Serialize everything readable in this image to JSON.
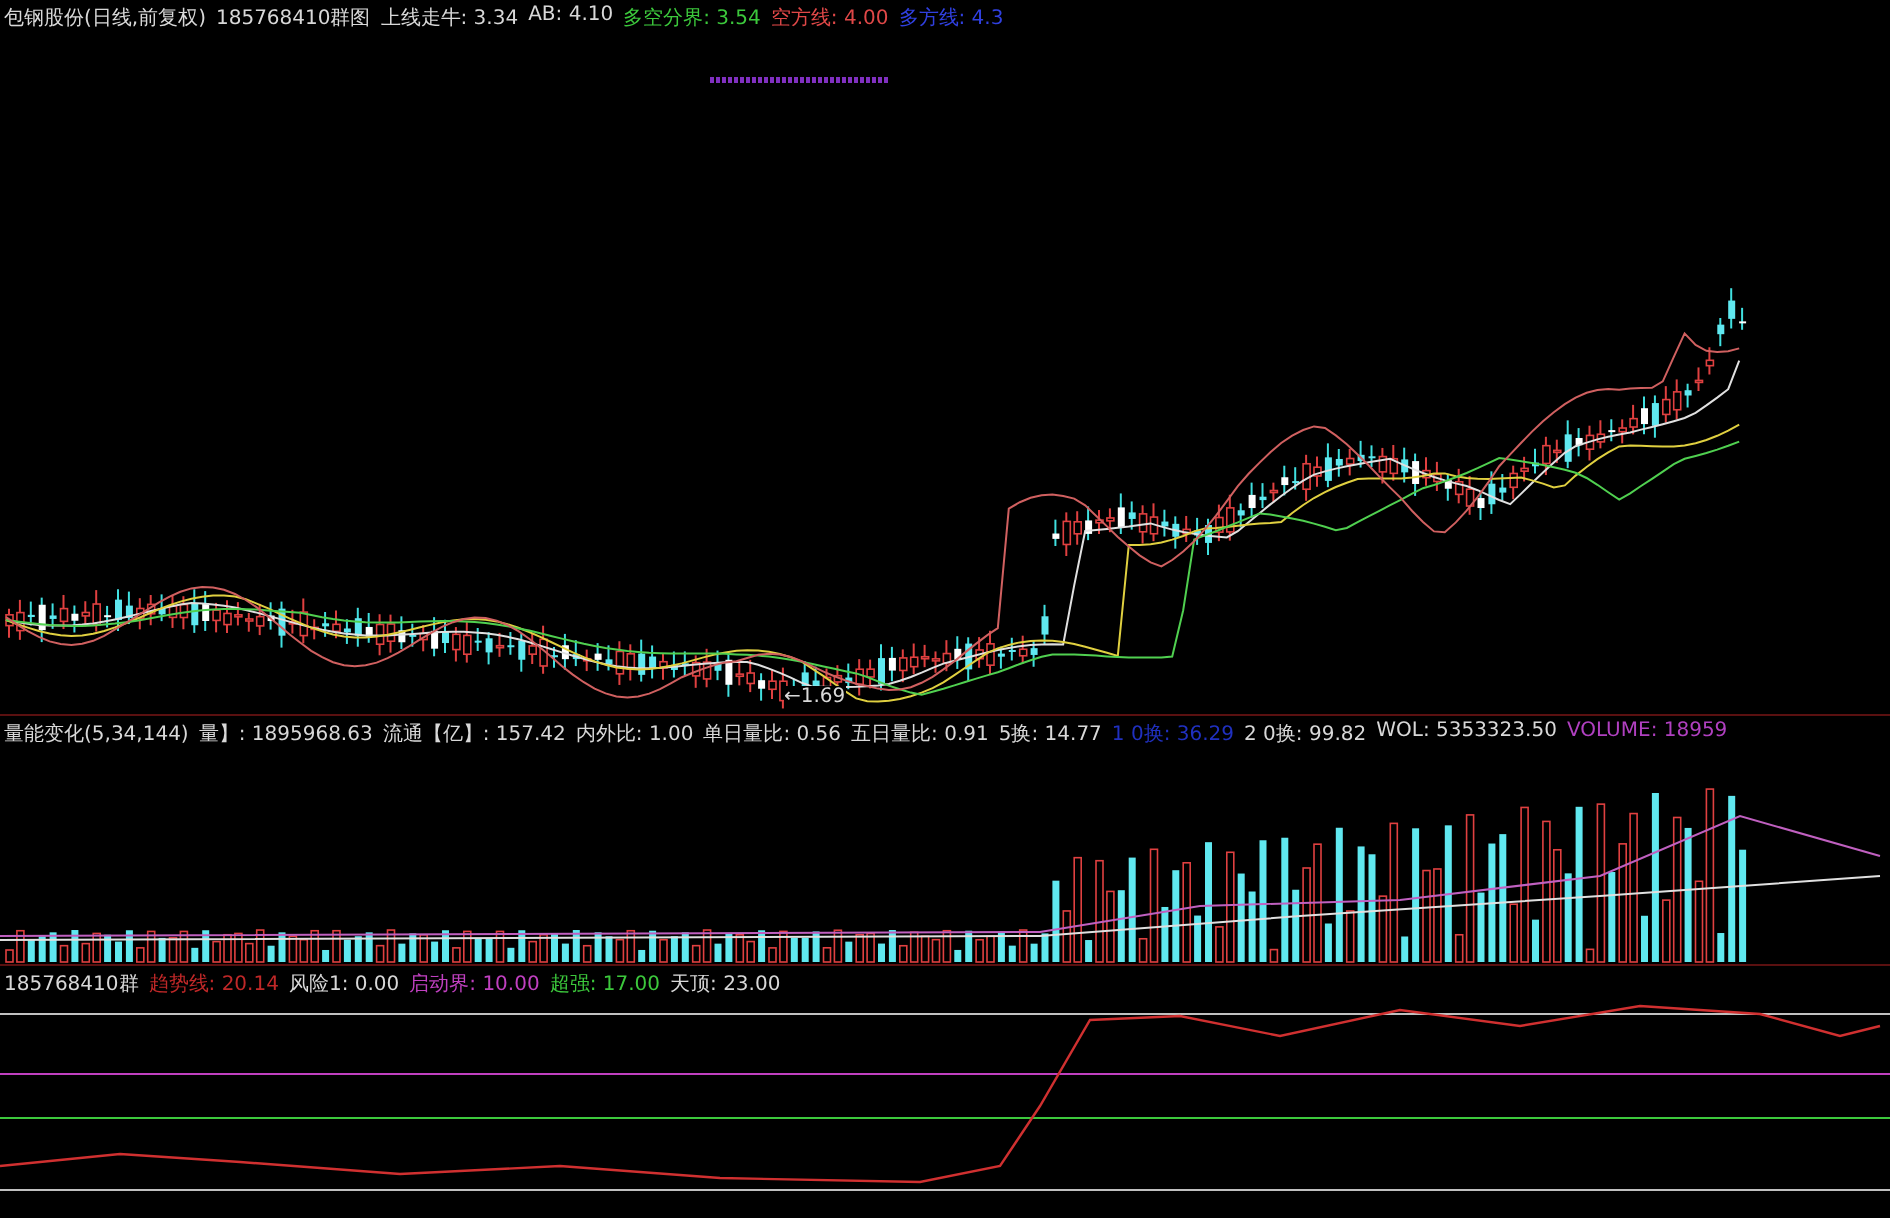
{
  "price_panel": {
    "title": "包钢股份(日线,前复权)",
    "legend": [
      {
        "label": "185768410群图",
        "color": "#d8d8d8"
      },
      {
        "label": "上线走牛: 3.34",
        "color": "#d8d8d8"
      },
      {
        "label": "AB: 4.10",
        "color": "#d8d8d8"
      },
      {
        "label": "多空分界: 3.54",
        "color": "#3cc83c"
      },
      {
        "label": "空方线: 4.00",
        "color": "#e04848"
      },
      {
        "label": "多方线: 4.3",
        "color": "#3040e0"
      }
    ],
    "low_marker": "←1.69"
  },
  "volume_panel": {
    "legend": [
      {
        "label": "量能变化(5,34,144)",
        "color": "#d8d8d8"
      },
      {
        "label": "量】: 1895968.63",
        "color": "#d8d8d8"
      },
      {
        "label": "流通【亿】: 157.42",
        "color": "#d8d8d8"
      },
      {
        "label": "内外比: 1.00",
        "color": "#d8d8d8"
      },
      {
        "label": "单日量比: 0.56",
        "color": "#d8d8d8"
      },
      {
        "label": "五日量比: 0.91",
        "color": "#d8d8d8"
      },
      {
        "label": "5换: 14.77",
        "color": "#d8d8d8"
      },
      {
        "label": "1 0换: 36.29",
        "color": "#2030c0"
      },
      {
        "label": "2 0换: 99.82",
        "color": "#d8d8d8"
      },
      {
        "label": "WOL: 5353323.50",
        "color": "#d8d8d8"
      },
      {
        "label": "VOLUME: 18959",
        "color": "#b040c0"
      }
    ]
  },
  "indicator_panel": {
    "legend": [
      {
        "label": "185768410群",
        "color": "#d8d8d8"
      },
      {
        "label": "趋势线: 20.14",
        "color": "#c02828"
      },
      {
        "label": "风险1: 0.00",
        "color": "#d8d8d8"
      },
      {
        "label": "启动界: 10.00",
        "color": "#c040c0"
      },
      {
        "label": "超强: 17.00",
        "color": "#3cc83c"
      },
      {
        "label": "天顶: 23.00",
        "color": "#d8d8d8"
      }
    ]
  }
}
